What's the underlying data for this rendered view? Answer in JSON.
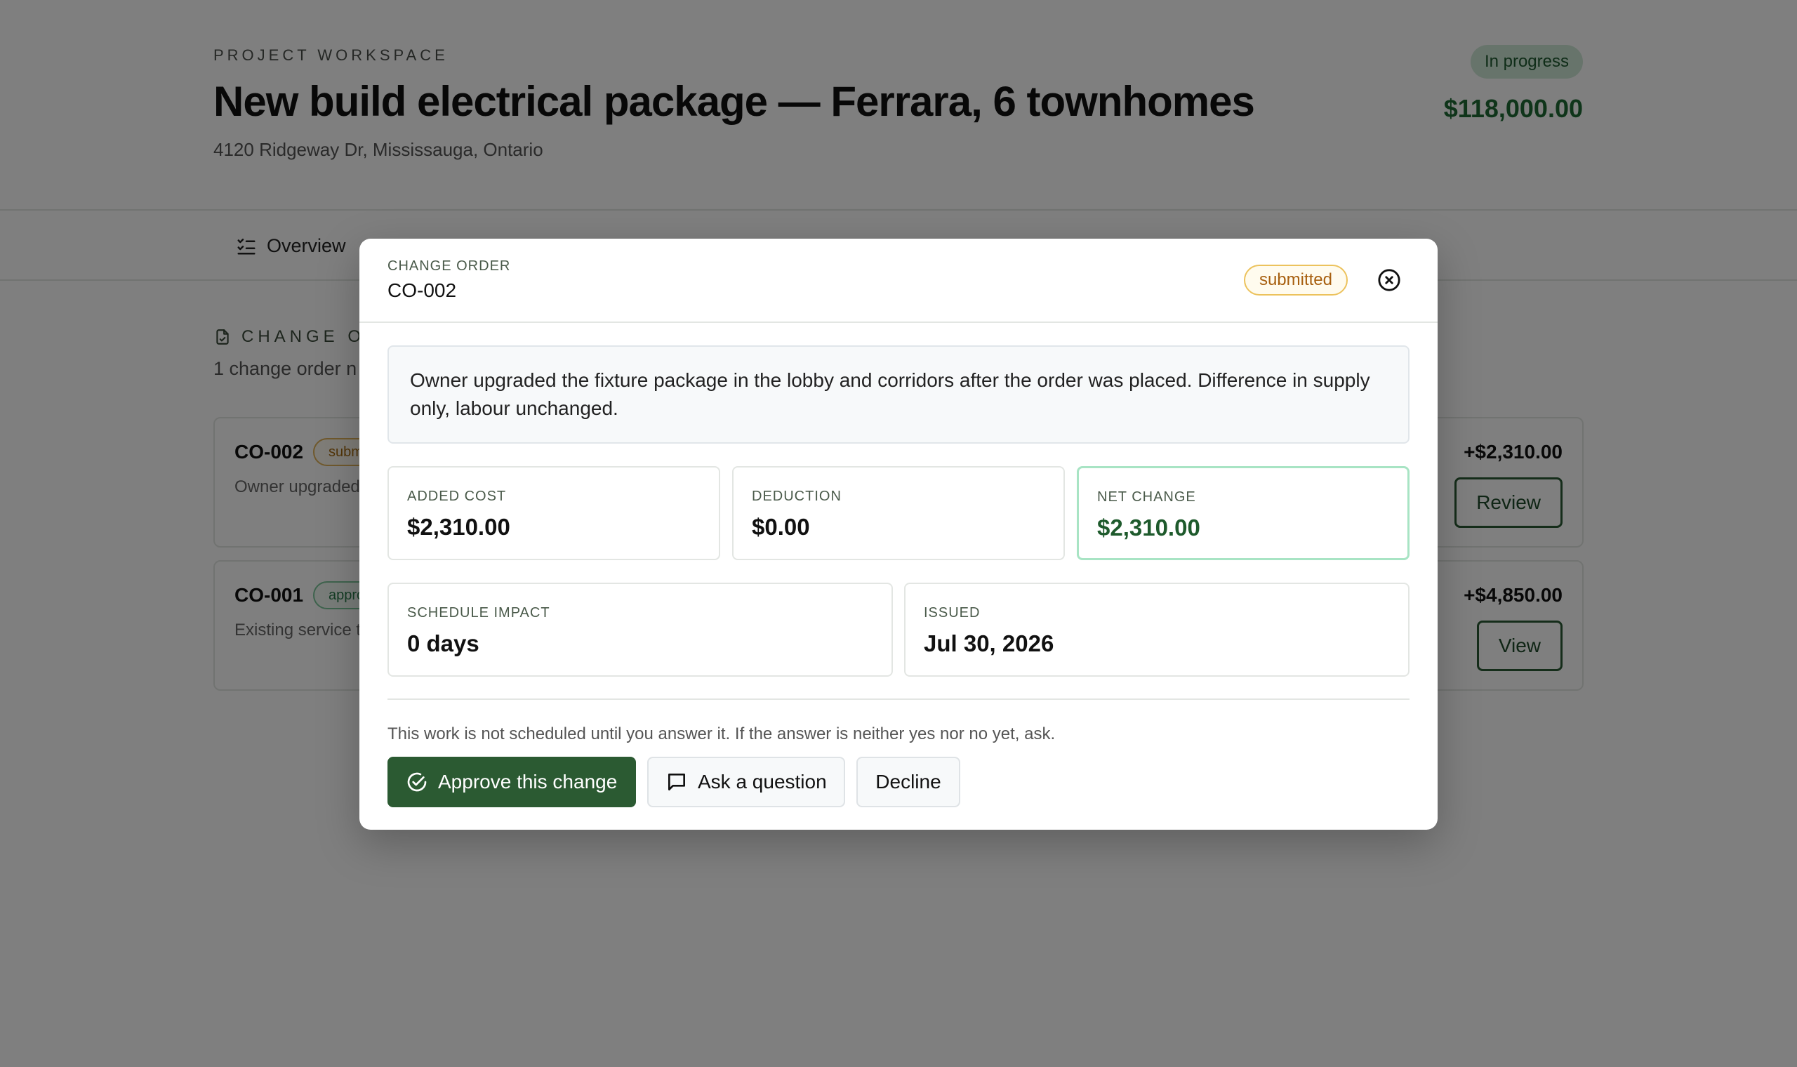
{
  "header": {
    "eyebrow": "PROJECT WORKSPACE",
    "title": "New build electrical package — Ferrara, 6 townhomes",
    "address": "4120 Ridgeway Dr, Mississauga, Ontario",
    "status": "In progress",
    "total": "$118,000.00"
  },
  "tabs": [
    {
      "label": "Overview",
      "icon": "checklist-icon"
    }
  ],
  "section": {
    "title": "CHANGE OR",
    "subtitle": "1 change order n"
  },
  "change_orders": [
    {
      "id": "CO-002",
      "badge": "subm",
      "desc": "Owner upgraded",
      "amount": "+$2,310.00",
      "action": "Review"
    },
    {
      "id": "CO-001",
      "badge": "appro",
      "desc": "Existing service te",
      "amount": "+$4,850.00",
      "action": "View"
    }
  ],
  "modal": {
    "eyebrow": "CHANGE ORDER",
    "title": "CO-002",
    "status": "submitted",
    "note": "Owner upgraded the fixture package in the lobby and corridors after the order was placed. Difference in supply only, labour unchanged.",
    "stats": {
      "added_cost": {
        "label": "ADDED COST",
        "value": "$2,310.00"
      },
      "deduction": {
        "label": "DEDUCTION",
        "value": "$0.00"
      },
      "net_change": {
        "label": "NET CHANGE",
        "value": "$2,310.00"
      },
      "schedule_impact": {
        "label": "SCHEDULE IMPACT",
        "value": "0 days"
      },
      "issued": {
        "label": "ISSUED",
        "value": "Jul 30, 2026"
      }
    },
    "hint": "This work is not scheduled until you answer it. If the answer is neither yes nor no yet, ask.",
    "actions": {
      "approve": "Approve this change",
      "ask": "Ask a question",
      "decline": "Decline"
    }
  },
  "colors": {
    "brand": "#2b5a32",
    "accent_green": "#1e6a34",
    "warning": "#a75f0f"
  }
}
